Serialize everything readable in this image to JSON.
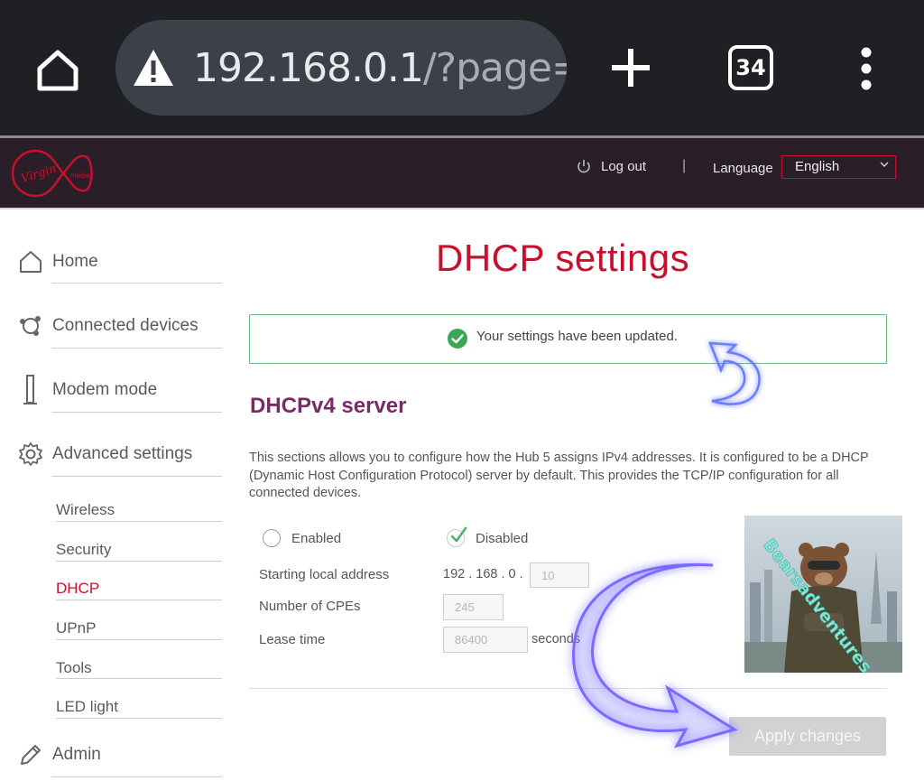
{
  "browser": {
    "url_host": "192.168.0.1",
    "url_rest": "/?page=se",
    "tab_count": "34"
  },
  "header": {
    "logo_text": "Virgin media",
    "logout_label": "Log out",
    "separator": "|",
    "language_label": "Language",
    "language_value": "English"
  },
  "sidebar": {
    "items": [
      {
        "label": "Home",
        "icon": "home-icon"
      },
      {
        "label": "Connected devices",
        "icon": "devices-icon"
      },
      {
        "label": "Modem mode",
        "icon": "modem-icon"
      },
      {
        "label": "Advanced settings",
        "icon": "gear-icon"
      },
      {
        "label": "Admin",
        "icon": "pencil-icon"
      }
    ],
    "subitems": [
      {
        "label": "Wireless"
      },
      {
        "label": "Security"
      },
      {
        "label": "DHCP",
        "active": true
      },
      {
        "label": "UPnP"
      },
      {
        "label": "Tools"
      },
      {
        "label": "LED light"
      }
    ]
  },
  "main": {
    "title": "DHCP settings",
    "notice": "Your settings have been updated.",
    "section_title": "DHCPv4 server",
    "description": "This sections allows you to configure how the Hub 5 assigns IPv4 addresses. It is configured to be a DHCP (Dynamic Host Configuration Protocol) server by default. This provides the TCP/IP configuration for all connected devices.",
    "radio_enabled": "Enabled",
    "radio_disabled": "Disabled",
    "selected_mode": "Disabled",
    "fields": {
      "start_label": "Starting local address",
      "start_prefix": "192 . 168 . 0 .",
      "start_value": "10",
      "cpe_label": "Number of CPEs",
      "cpe_value": "245",
      "lease_label": "Lease time",
      "lease_value": "86400",
      "lease_units": "seconds"
    },
    "apply_label": "Apply changes"
  },
  "overlay": {
    "watermark": "Bearsadventures"
  },
  "colors": {
    "brand_red": "#c8102e",
    "header_bg": "#2a1e28",
    "section_purple": "#7a2a66",
    "success_green": "#3aa757"
  }
}
